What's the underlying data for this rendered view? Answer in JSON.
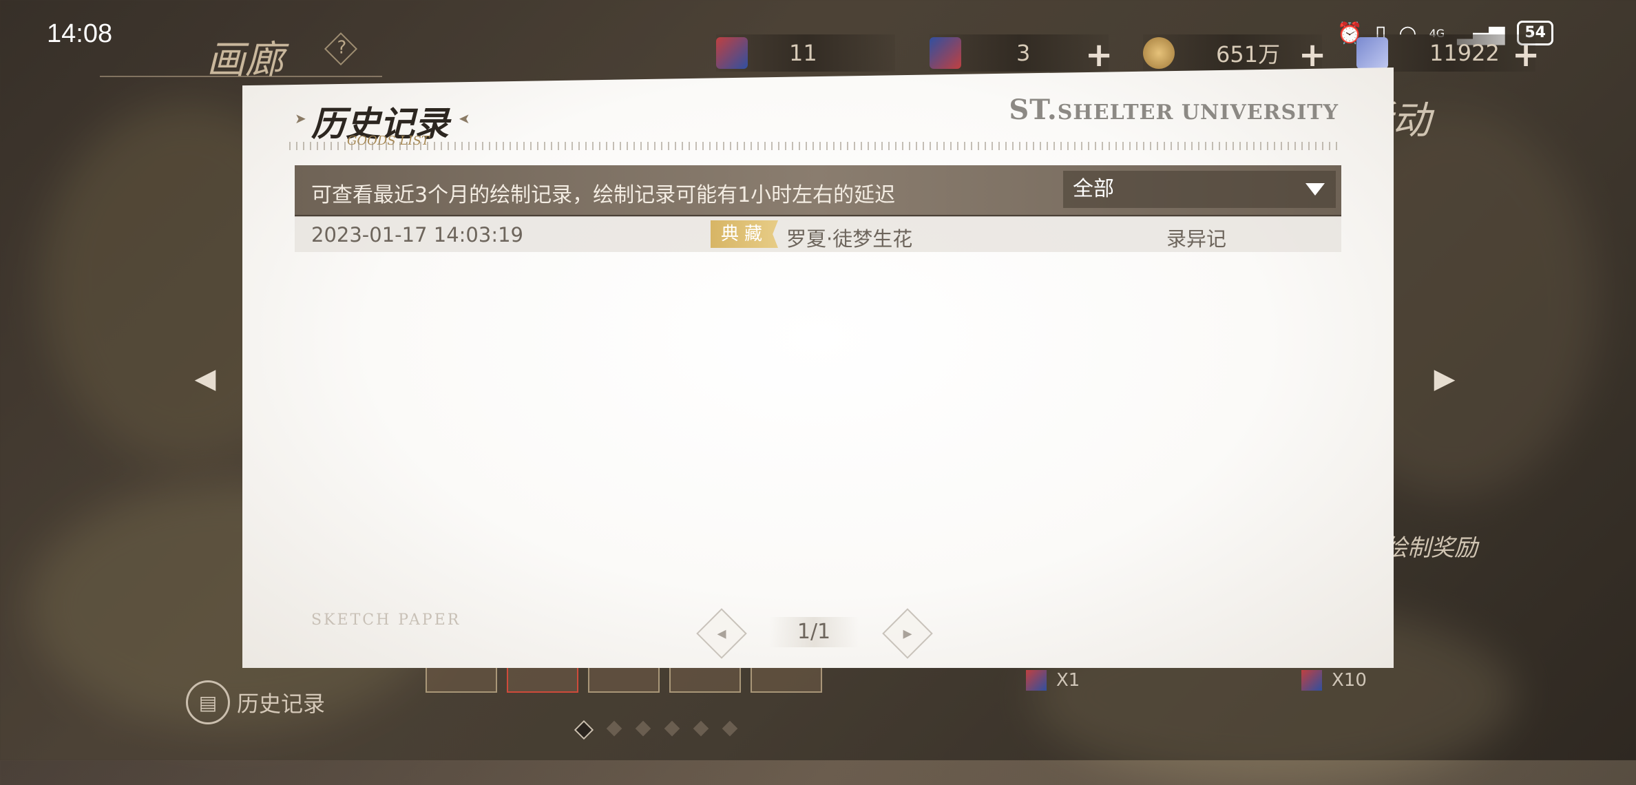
{
  "status_bar": {
    "time": "14:08",
    "network": "4G",
    "battery": "54"
  },
  "hud": {
    "page_title": "画廊",
    "help_label": "?",
    "resources": [
      {
        "name": "ticket-a",
        "value": "11"
      },
      {
        "name": "ticket-b",
        "value": "3"
      },
      {
        "name": "coins",
        "value": "651万"
      },
      {
        "name": "gems",
        "value": "11922"
      }
    ],
    "plus_label": "+"
  },
  "background_labels": {
    "activity": "活动",
    "reward": "绘制奖励"
  },
  "dialog": {
    "title": "历史记录",
    "subtitle": "GOODS LIST",
    "brand_prefix": "ST.",
    "brand": "SHELTER UNIVERSITY",
    "filter_hint": "可查看最近3个月的绘制记录，绘制记录可能有1小时左右的延迟",
    "filter_value": "全部",
    "records": [
      {
        "time": "2023-01-17  14:03:19",
        "tag": "典藏",
        "item": "罗夏·徒梦生花",
        "pool": "录异记"
      }
    ],
    "footer_watermark": "SKETCH PAPER",
    "pagination": "1/1"
  },
  "bottom": {
    "history_label": "历史记录",
    "draw_once": "X1",
    "draw_ten": "X10"
  },
  "colors": {
    "filter_bar": "#7d7064",
    "badge_gold": "#d7b565",
    "dialog_bg": "#fbfaf8"
  }
}
